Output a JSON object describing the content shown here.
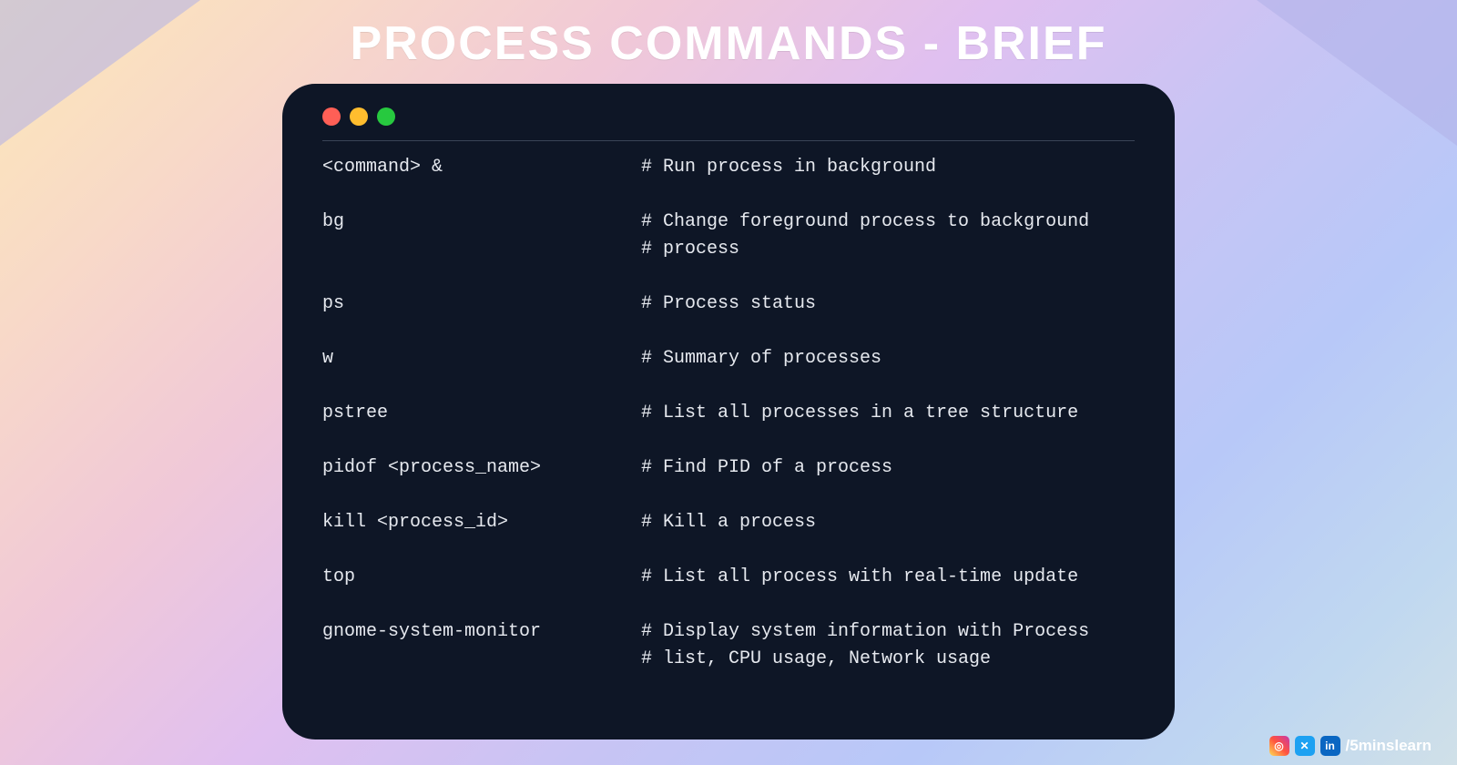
{
  "title": "PROCESS COMMANDS - BRIEF",
  "terminal": {
    "rows": [
      {
        "cmd": "<command> &",
        "desc": [
          "# Run process in background"
        ]
      },
      {
        "cmd": "bg",
        "desc": [
          "# Change foreground process to background",
          "# process"
        ]
      },
      {
        "cmd": "ps",
        "desc": [
          "# Process status"
        ]
      },
      {
        "cmd": "w",
        "desc": [
          "# Summary of processes"
        ]
      },
      {
        "cmd": "pstree",
        "desc": [
          "# List all processes in a tree structure"
        ]
      },
      {
        "cmd": "pidof <process_name>",
        "desc": [
          "# Find PID of a process"
        ]
      },
      {
        "cmd": "kill <process_id>",
        "desc": [
          "# Kill a process"
        ]
      },
      {
        "cmd": "top",
        "desc": [
          "# List all process with real-time update"
        ]
      },
      {
        "cmd": "gnome-system-monitor",
        "desc": [
          "# Display system information with Process",
          "# list, CPU usage, Network usage"
        ]
      }
    ]
  },
  "footer": {
    "handle": "/5minslearn",
    "icons": {
      "instagram": "◎",
      "twitter": "✕",
      "linkedin": "in"
    }
  }
}
